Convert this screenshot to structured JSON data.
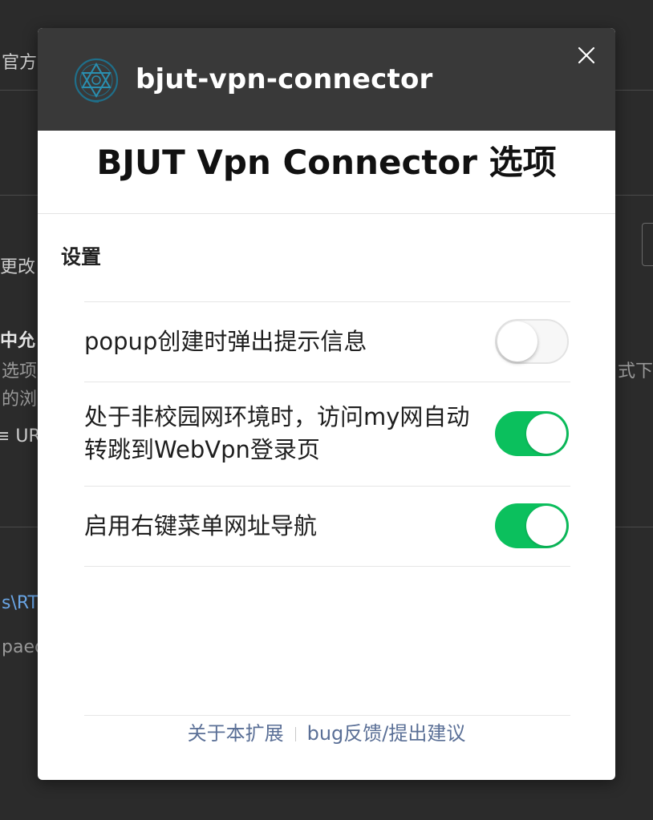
{
  "background": {
    "fragments": [
      "官方",
      "更改",
      "中允",
      "选项，",
      "的浏",
      "≡ UR",
      "s\\RT",
      "paed",
      "式下，"
    ]
  },
  "dialog": {
    "app_name": "bjut-vpn-connector",
    "logo_icon": "bjut-star-logo-icon",
    "close_icon": "close-icon",
    "page_heading": "BJUT Vpn Connector 选项",
    "section_label": "设置",
    "settings": [
      {
        "label": "popup创建时弹出提示信息",
        "enabled": false
      },
      {
        "label": "处于非校园网环境时，访问my网自动转跳到WebVpn登录页",
        "enabled": true
      },
      {
        "label": "启用右键菜单网址导航",
        "enabled": true
      }
    ],
    "footer": {
      "about_link": "关于本扩展",
      "feedback_link": "bug反馈/提出建议"
    }
  },
  "colors": {
    "toggle_on": "#0bc05d",
    "header_bg": "#393939",
    "link": "#5a6f96"
  }
}
